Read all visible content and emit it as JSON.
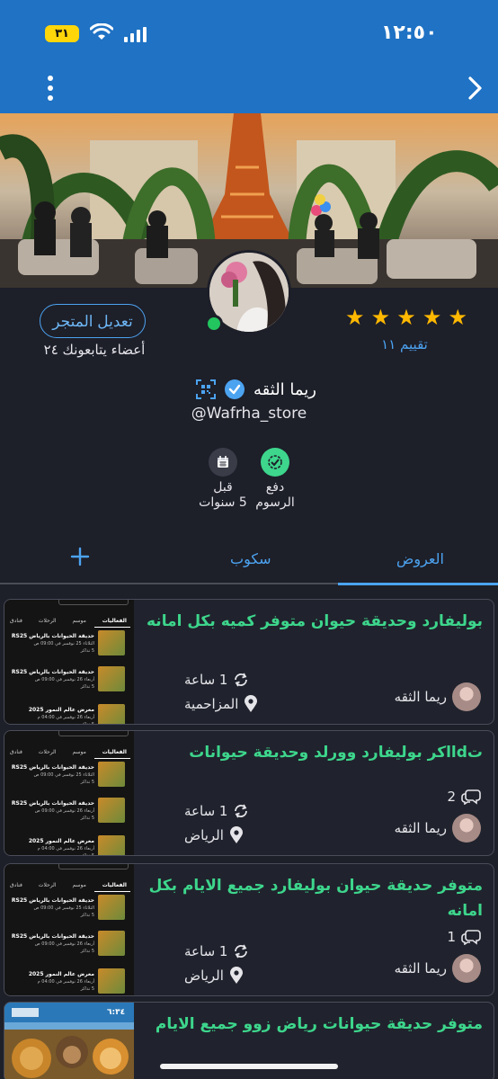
{
  "status_bar": {
    "time": "١٢:٥٠",
    "battery": "٣١"
  },
  "profile": {
    "store_name": "ريما الثقه",
    "handle": "@Wafrha_store",
    "rating_label": "تقييم ١١",
    "stars": 5,
    "edit_button": "تعديل المتجر",
    "followers_text": "أعضاء يتابعونك ٢٤",
    "badges": [
      {
        "line1": "دفع",
        "line2": "الرسوم",
        "icon": "check-badge-icon",
        "color": "#3dd68c"
      },
      {
        "line1": "قبل",
        "line2": "5 سنوات",
        "icon": "calendar-icon",
        "color": "#3a3d48"
      }
    ]
  },
  "tabs": {
    "offers": "العروض",
    "scoops": "سكوب"
  },
  "cards": [
    {
      "title": "بوليفارد وحديقة حيوان متوفر كميه بكل امانه",
      "seller": "ريما الثقه",
      "time": "1 ساعة",
      "location": "المزاحمية",
      "comments": ""
    },
    {
      "title": "تdااكر بوليفارد وورلد وحديقة حيوانات",
      "seller": "ريما الثقه",
      "time": "1 ساعة",
      "location": "الرياض",
      "comments": "2"
    },
    {
      "title": "متوفر حديقة حيوان بوليفارد جميع الايام بكل امانه",
      "seller": "ريما الثقه",
      "time": "1 ساعة",
      "location": "الرياض",
      "comments": "1"
    },
    {
      "title": "متوفر حديقة حيوانات رياض زوو جميع الايام",
      "seller": "",
      "time": "",
      "location": "",
      "comments": ""
    }
  ],
  "thumb_text": {
    "tabs": [
      "الفعاليات",
      "موسم",
      "الرحلات",
      "فنادق"
    ],
    "events": [
      {
        "title": "حديقة الحيوانات بالرياض RS25",
        "sub": "الثلاثاء 25 نوفمبر في 09:00 ص",
        "tickets": "5 تذاكر"
      },
      {
        "title": "حديقة الحيوانات بالرياض RS25",
        "sub": "أربعاء 26 نوفمبر في 09:00 ص",
        "tickets": "5 تذاكر"
      },
      {
        "title": "معرض عالم النمور 2025",
        "sub": "أربعاء 26 نوفمبر في 04:00 م",
        "tickets": "5 تذاكر"
      }
    ],
    "poster_time": "٦:٣٤"
  },
  "colors": {
    "accent": "#4ca3f0",
    "title_green": "#3dd68c",
    "nav_blue": "#1f72c4",
    "star": "#ffb800"
  }
}
